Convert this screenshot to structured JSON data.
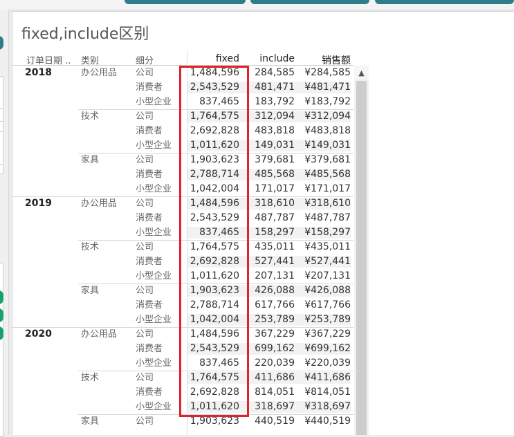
{
  "title": "fixed,include区别",
  "headers": {
    "order_date": "订单日期 ..",
    "category": "类别",
    "segment": "细分",
    "fixed": "fixed",
    "include": "include",
    "sales": "销售额"
  },
  "icons": {
    "scroll_up": "▲"
  },
  "colors": {
    "highlight": "#e4202a",
    "band": "#f2f2f2",
    "teal": "#2f7d8c",
    "green": "#16a36a"
  },
  "rows": [
    {
      "year": "2018",
      "category": "办公用品",
      "segment": "公司",
      "fixed": "1,484,596",
      "include": "284,585",
      "sales": "¥284,585"
    },
    {
      "year": "",
      "category": "",
      "segment": "消费者",
      "fixed": "2,543,529",
      "include": "481,471",
      "sales": "¥481,471"
    },
    {
      "year": "",
      "category": "",
      "segment": "小型企业",
      "fixed": "837,465",
      "include": "183,792",
      "sales": "¥183,792"
    },
    {
      "year": "",
      "category": "技术",
      "segment": "公司",
      "fixed": "1,764,575",
      "include": "312,094",
      "sales": "¥312,094"
    },
    {
      "year": "",
      "category": "",
      "segment": "消费者",
      "fixed": "2,692,828",
      "include": "483,818",
      "sales": "¥483,818"
    },
    {
      "year": "",
      "category": "",
      "segment": "小型企业",
      "fixed": "1,011,620",
      "include": "149,031",
      "sales": "¥149,031"
    },
    {
      "year": "",
      "category": "家具",
      "segment": "公司",
      "fixed": "1,903,623",
      "include": "379,681",
      "sales": "¥379,681"
    },
    {
      "year": "",
      "category": "",
      "segment": "消费者",
      "fixed": "2,788,714",
      "include": "485,568",
      "sales": "¥485,568"
    },
    {
      "year": "",
      "category": "",
      "segment": "小型企业",
      "fixed": "1,042,004",
      "include": "171,017",
      "sales": "¥171,017"
    },
    {
      "year": "2019",
      "category": "办公用品",
      "segment": "公司",
      "fixed": "1,484,596",
      "include": "318,610",
      "sales": "¥318,610"
    },
    {
      "year": "",
      "category": "",
      "segment": "消费者",
      "fixed": "2,543,529",
      "include": "487,787",
      "sales": "¥487,787"
    },
    {
      "year": "",
      "category": "",
      "segment": "小型企业",
      "fixed": "837,465",
      "include": "158,297",
      "sales": "¥158,297"
    },
    {
      "year": "",
      "category": "技术",
      "segment": "公司",
      "fixed": "1,764,575",
      "include": "435,011",
      "sales": "¥435,011"
    },
    {
      "year": "",
      "category": "",
      "segment": "消费者",
      "fixed": "2,692,828",
      "include": "527,441",
      "sales": "¥527,441"
    },
    {
      "year": "",
      "category": "",
      "segment": "小型企业",
      "fixed": "1,011,620",
      "include": "207,131",
      "sales": "¥207,131"
    },
    {
      "year": "",
      "category": "家具",
      "segment": "公司",
      "fixed": "1,903,623",
      "include": "426,088",
      "sales": "¥426,088"
    },
    {
      "year": "",
      "category": "",
      "segment": "消费者",
      "fixed": "2,788,714",
      "include": "617,766",
      "sales": "¥617,766"
    },
    {
      "year": "",
      "category": "",
      "segment": "小型企业",
      "fixed": "1,042,004",
      "include": "253,789",
      "sales": "¥253,789"
    },
    {
      "year": "2020",
      "category": "办公用品",
      "segment": "公司",
      "fixed": "1,484,596",
      "include": "367,229",
      "sales": "¥367,229"
    },
    {
      "year": "",
      "category": "",
      "segment": "消费者",
      "fixed": "2,543,529",
      "include": "699,162",
      "sales": "¥699,162"
    },
    {
      "year": "",
      "category": "",
      "segment": "小型企业",
      "fixed": "837,465",
      "include": "220,039",
      "sales": "¥220,039"
    },
    {
      "year": "",
      "category": "技术",
      "segment": "公司",
      "fixed": "1,764,575",
      "include": "411,686",
      "sales": "¥411,686"
    },
    {
      "year": "",
      "category": "",
      "segment": "消费者",
      "fixed": "2,692,828",
      "include": "814,051",
      "sales": "¥814,051"
    },
    {
      "year": "",
      "category": "",
      "segment": "小型企业",
      "fixed": "1,011,620",
      "include": "318,697",
      "sales": "¥318,697"
    },
    {
      "year": "",
      "category": "家具",
      "segment": "公司",
      "fixed": "1,903,623",
      "include": "440,519",
      "sales": "¥440,519"
    }
  ]
}
